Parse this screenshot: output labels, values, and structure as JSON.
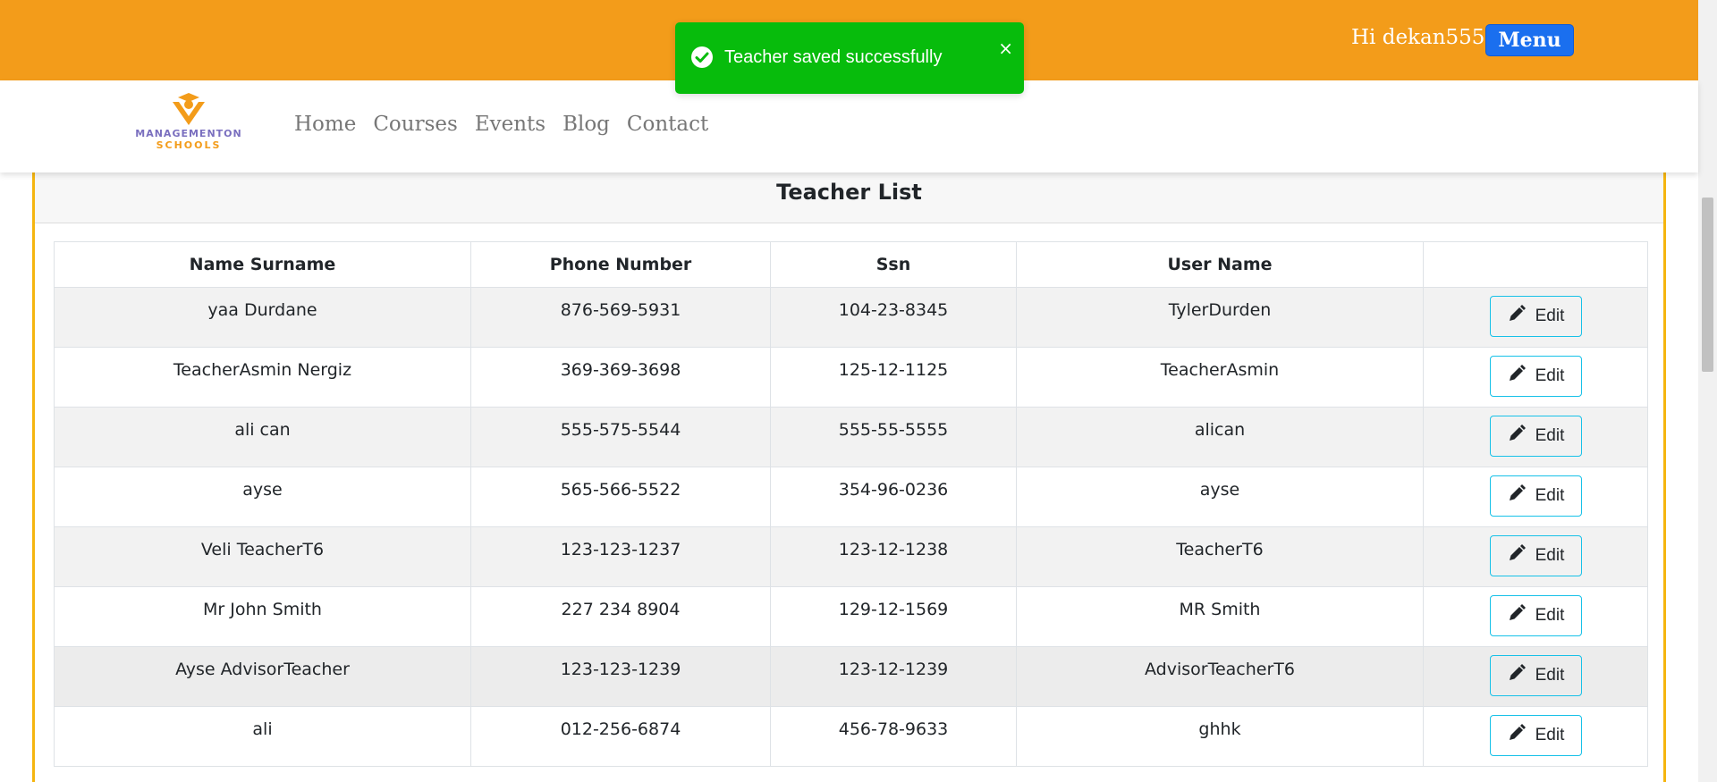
{
  "header": {
    "greeting": "Hi dekan555",
    "menu_label": "Menu",
    "brand_color": "#f39c1a"
  },
  "toast": {
    "message": "Teacher saved successfully",
    "close": "×",
    "color": "#07bc0c",
    "icon": "check-circle-icon"
  },
  "navbar": {
    "logo_line1": "MANAGEMENTON",
    "logo_line2": "SCHOOLS",
    "links": [
      "Home",
      "Courses",
      "Events",
      "Blog",
      "Contact"
    ]
  },
  "card": {
    "title": "Teacher List"
  },
  "table": {
    "headers": [
      "Name Surname",
      "Phone Number",
      "Ssn",
      "User Name",
      ""
    ],
    "edit_label": "Edit",
    "rows": [
      {
        "name": "yaa Durdane",
        "phone": "876-569-5931",
        "ssn": "104-23-8345",
        "username": "TylerDurden"
      },
      {
        "name": "TeacherAsmin Nergiz",
        "phone": "369-369-3698",
        "ssn": "125-12-1125",
        "username": "TeacherAsmin"
      },
      {
        "name": "ali can",
        "phone": "555-575-5544",
        "ssn": "555-55-5555",
        "username": "alican"
      },
      {
        "name": "ayse",
        "phone": "565-566-5522",
        "ssn": "354-96-0236",
        "username": "ayse"
      },
      {
        "name": "Veli TeacherT6",
        "phone": "123-123-1237",
        "ssn": "123-12-1238",
        "username": "TeacherT6"
      },
      {
        "name": "Mr John Smith",
        "phone": "227 234 8904",
        "ssn": "129-12-1569",
        "username": "MR Smith"
      },
      {
        "name": "Ayse AdvisorTeacher",
        "phone": "123-123-1239",
        "ssn": "123-12-1239",
        "username": "AdvisorTeacherT6"
      },
      {
        "name": "ali",
        "phone": "012-256-6874",
        "ssn": "456-78-9633",
        "username": "ghhk"
      }
    ]
  }
}
